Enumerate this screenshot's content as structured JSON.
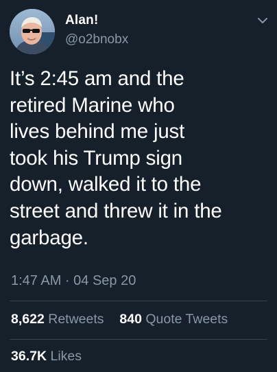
{
  "author": {
    "display_name": "Alan!",
    "handle": "@o2bnobx",
    "avatar_icon": "profile-photo-icon"
  },
  "tweet": {
    "text": "It’s 2:45 am and the\nretired Marine who\nlives behind me just\ntook his Trump sign\ndown, walked it to the\nstreet and threw it in the\ngarbage.",
    "timestamp": "1:47 AM · 04 Sep 20"
  },
  "stats": {
    "retweets_count": "8,622",
    "retweets_label": "Retweets",
    "quote_tweets_count": "840",
    "quote_tweets_label": "Quote Tweets",
    "likes_count": "36.7K",
    "likes_label": "Likes"
  },
  "colors": {
    "background": "#15202b",
    "text_primary": "#ffffff",
    "text_secondary": "#8899a6",
    "divider": "#38444d"
  },
  "icons": {
    "menu": "chevron-down-icon"
  }
}
